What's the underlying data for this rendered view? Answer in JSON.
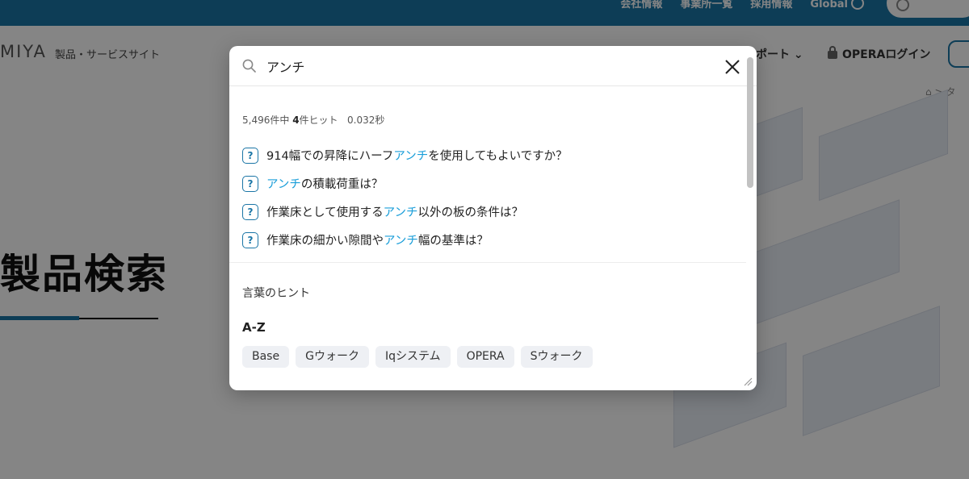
{
  "topbar": {
    "links": [
      "会社情報",
      "事業所一覧",
      "採用情報",
      "Global"
    ]
  },
  "header": {
    "logo": "MIYA",
    "site_subtitle": "製品・サービスサイト",
    "nav_support": "ポート ⌄",
    "nav_login": "OPERAログイン"
  },
  "breadcrumb": {
    "separator": ">",
    "next": "タ"
  },
  "hero": {
    "title": "製品検索"
  },
  "modal": {
    "search": {
      "value": "アンチ",
      "icon": "search-icon"
    },
    "hit_info": {
      "prefix": "5,496件中",
      "count": "4",
      "middle": "件ヒット",
      "time": "0.032秒"
    },
    "results": [
      {
        "before": "914幅での昇降にハーフ",
        "highlight": "アンチ",
        "after": "を使用してもよいですか？"
      },
      {
        "before": "",
        "highlight": "アンチ",
        "after": "の積載荷重は？"
      },
      {
        "before": "作業床として使用する",
        "highlight": "アンチ",
        "after": "以外の板の条件は？"
      },
      {
        "before": "作業床の細かい隙間や",
        "highlight": "アンチ",
        "after": "幅の基準は？"
      }
    ],
    "result_icon_glyph": "?",
    "hint_title": "言葉のヒント",
    "az_title": "A-Z",
    "tags": [
      "Base",
      "Gウォーク",
      "Iqシステム",
      "OPERA",
      "Sウォーク"
    ]
  },
  "colors": {
    "brand": "#1a75a6",
    "highlight": "#1a9ed9"
  }
}
